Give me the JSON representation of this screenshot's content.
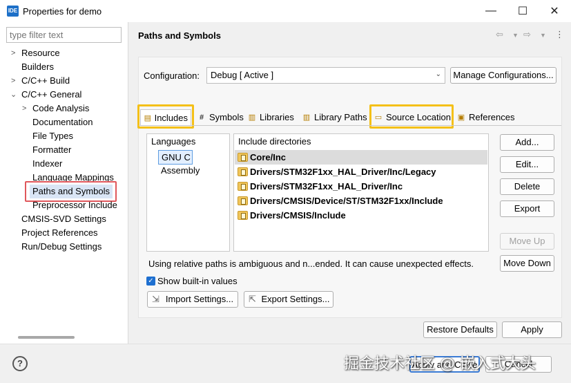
{
  "window": {
    "app_icon_text": "IDE",
    "title": "Properties for demo",
    "minimize_glyph": "—",
    "maximize_glyph": "☐",
    "close_glyph": "✕"
  },
  "left": {
    "filter_placeholder": "type filter text",
    "tree": [
      {
        "label": "Resource",
        "expandable": true
      },
      {
        "label": "Builders",
        "expandable": false
      },
      {
        "label": "C/C++ Build",
        "expandable": true
      },
      {
        "label": "C/C++ General",
        "expandable": true,
        "expanded": true
      },
      {
        "label": "Code Analysis",
        "expandable": true
      },
      {
        "label": "Documentation"
      },
      {
        "label": "File Types"
      },
      {
        "label": "Formatter"
      },
      {
        "label": "Indexer"
      },
      {
        "label": "Language Mappings"
      },
      {
        "label": "Paths and Symbols",
        "selected": true
      },
      {
        "label": "Preprocessor Include"
      },
      {
        "label": "CMSIS-SVD Settings"
      },
      {
        "label": "Project References"
      },
      {
        "label": "Run/Debug Settings"
      }
    ]
  },
  "page": {
    "title": "Paths and Symbols",
    "nav_icons": [
      "back-arrow-icon",
      "dropdown-icon",
      "forward-arrow-icon",
      "dropdown-icon",
      "menu-icon"
    ]
  },
  "configuration": {
    "label": "Configuration:",
    "value": "Debug  [ Active ]",
    "manage_button": "Manage Configurations..."
  },
  "tabs": [
    {
      "label": "Includes",
      "active": true,
      "highlighted": true,
      "icon": "includes-icon"
    },
    {
      "label": "Symbols",
      "icon": "hash-icon"
    },
    {
      "label": "Libraries",
      "icon": "libraries-icon"
    },
    {
      "label": "Library Paths",
      "icon": "library-paths-icon"
    },
    {
      "label": "Source Location",
      "highlighted": true,
      "icon": "source-folder-icon"
    },
    {
      "label": "References",
      "icon": "references-icon"
    }
  ],
  "languages": {
    "header": "Languages",
    "items": [
      {
        "label": "GNU C",
        "selected": true
      },
      {
        "label": "Assembly"
      }
    ]
  },
  "include_dirs": {
    "header": "Include directories",
    "items": [
      "Core/Inc",
      "Drivers/STM32F1xx_HAL_Driver/Inc/Legacy",
      "Drivers/STM32F1xx_HAL_Driver/Inc",
      "Drivers/CMSIS/Device/ST/STM32F1xx/Include",
      "Drivers/CMSIS/Include"
    ]
  },
  "side_buttons": {
    "add": "Add...",
    "edit": "Edit...",
    "delete": "Delete",
    "export": "Export",
    "move_up": "Move Up",
    "move_down": "Move Down"
  },
  "info_text": "Using relative paths is ambiguous and n...ended. It can cause unexpected effects.",
  "show_builtin": {
    "label": "Show built-in values",
    "checked": true
  },
  "import_button": "Import Settings...",
  "export_button": "Export Settings...",
  "restore_button": "Restore Defaults",
  "apply_button": "Apply",
  "apply_close_button": "Apply and Close",
  "cancel_button": "Cancel",
  "help_glyph": "?",
  "watermark": "掘金技术社区 @ 嵌入式大头"
}
